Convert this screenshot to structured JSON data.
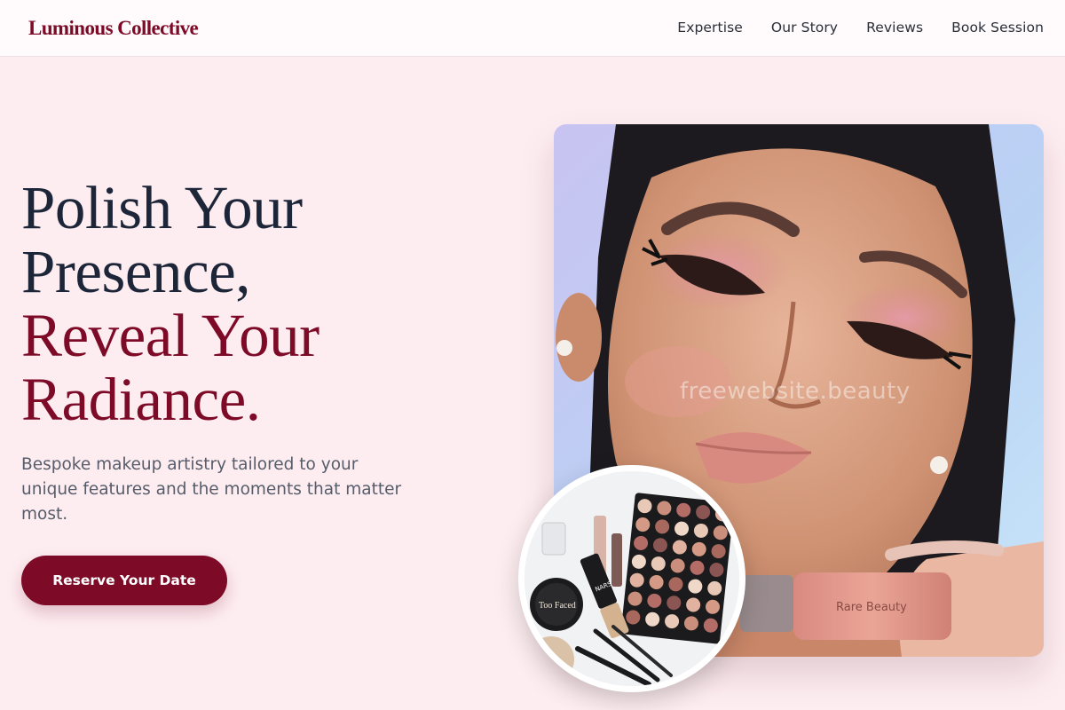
{
  "brand": {
    "name": "Luminous Collective",
    "color": "#7d0a27"
  },
  "nav": {
    "items": [
      {
        "label": "Expertise"
      },
      {
        "label": "Our Story"
      },
      {
        "label": "Reviews"
      },
      {
        "label": "Book Session"
      }
    ]
  },
  "hero": {
    "headline": {
      "line1": "Polish Your",
      "line2": "Presence,",
      "line3": "Reveal Your",
      "line4": "Radiance."
    },
    "subtext": "Bespoke makeup artistry tailored to your unique features and the moments that matter most.",
    "cta_label": "Reserve Your Date",
    "portrait_watermark": "freewebsite.beauty",
    "product_label": "Rare Beauty",
    "compact_label": "Too Faced",
    "small_product_label": "NARS"
  },
  "colors": {
    "background": "#fdedf1",
    "accent": "#7d0a27",
    "heading_dark": "#1d2538",
    "body_text": "#565c69"
  }
}
